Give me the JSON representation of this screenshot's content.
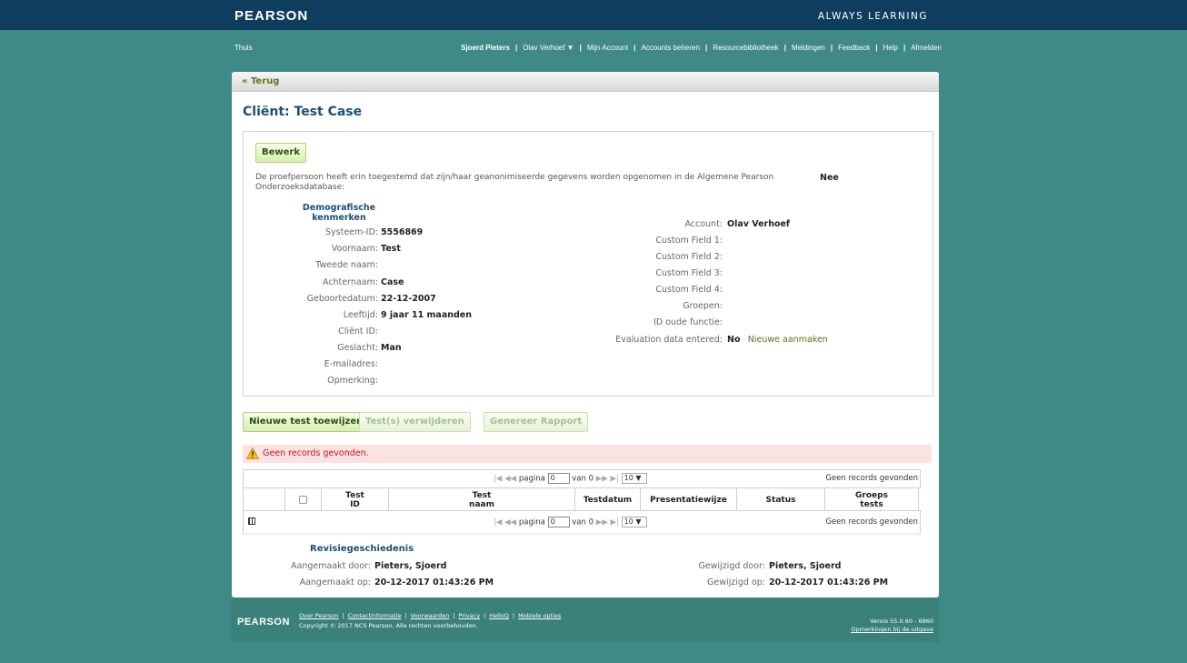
{
  "header": {
    "logo": "PEARSON",
    "tagline": "ALWAYS LEARNING"
  },
  "nav": {
    "home": "Thuis",
    "user": "Sjoerd Pieters",
    "account_menu": "Olav Verhoef ▼",
    "links": [
      "Mijn Account",
      "Accounts beheren",
      "Resourcebibliotheek",
      "Meldingen",
      "Feedback",
      "Help",
      "Afmelden"
    ]
  },
  "back": "« Terug",
  "title": "Cliënt: Test Case",
  "edit_label": "Bewerk",
  "consent": {
    "text": "De proefpersoon heeft erin toegestemd dat zijn/haar geanonimiseerde gegevens worden opgenomen in de Algemene Pearson Onderzoeksdatabase:",
    "value": "Nee"
  },
  "demographics": {
    "heading": "Demografische kenmerken",
    "fields": [
      {
        "label": "Systeem-ID:",
        "value": "5556869"
      },
      {
        "label": "Voornaam:",
        "value": "Test"
      },
      {
        "label": "Tweede naam:",
        "value": ""
      },
      {
        "label": "Achternaam:",
        "value": "Case"
      },
      {
        "label": "Geboortedatum:",
        "value": "22-12-2007"
      },
      {
        "label": "Leeftijd:",
        "value": "9 jaar 11 maanden"
      },
      {
        "label": "Cliënt ID:",
        "value": ""
      },
      {
        "label": "Geslacht:",
        "value": "Man"
      },
      {
        "label": "E-mailadres:",
        "value": ""
      },
      {
        "label": "Opmerking:",
        "value": ""
      }
    ]
  },
  "account_fields": [
    {
      "label": "Account:",
      "value": "Olav Verhoef"
    },
    {
      "label": "Custom Field 1:",
      "value": ""
    },
    {
      "label": "Custom Field 2:",
      "value": ""
    },
    {
      "label": "Custom Field 3:",
      "value": ""
    },
    {
      "label": "Custom Field 4:",
      "value": ""
    },
    {
      "label": "Groepen:",
      "value": ""
    },
    {
      "label": "ID oude functie:",
      "value": ""
    },
    {
      "label": "Evaluation data entered:",
      "value": "No",
      "link": "Nieuwe aanmaken"
    }
  ],
  "actions": {
    "assign": "Nieuwe test toewijzen",
    "delete": "Test(s) verwijderen",
    "report": "Genereer Rapport"
  },
  "alert": "Geen records gevonden.",
  "grid": {
    "pager": {
      "arrows_left": "|◀ ◀◀",
      "page_label": "pagina",
      "page_value": "0",
      "of_label": "van 0",
      "arrows_right": "▶▶ ▶|",
      "page_size": "10 ▼",
      "no_records": "Geen records gevonden"
    },
    "columns": [
      {
        "l1": "Test",
        "l2": "ID"
      },
      {
        "l1": "Test",
        "l2": "naam"
      },
      {
        "l1": "Testdatum",
        "l2": ""
      },
      {
        "l1": "Presentatiewijze",
        "l2": ""
      },
      {
        "l1": "Status",
        "l2": ""
      },
      {
        "l1": "Groeps",
        "l2": "tests"
      }
    ]
  },
  "revision": {
    "heading": "Revisiegeschiedenis",
    "created_by_label": "Aangemaakt door:",
    "created_by": "Pieters, Sjoerd",
    "created_on_label": "Aangemaakt op:",
    "created_on": "20-12-2017 01:43:26 PM",
    "modified_by_label": "Gewijzigd door:",
    "modified_by": "Pieters, Sjoerd",
    "modified_on_label": "Gewijzigd op:",
    "modified_on": "20-12-2017 01:43:26 PM"
  },
  "footer": {
    "logo": "PEARSON",
    "links": [
      "Over Pearson",
      "Contactinformatie",
      "Voorwaarden",
      "Privacy",
      "HelloQ",
      "Mobiele opties"
    ],
    "copyright": "Copyright © 2017 NCS Pearson, Alle rechten voorbehouden.",
    "version": "Versie 55.0.60 - 6860",
    "release_notes": "Opmerkingen bij de uitgave"
  },
  "colors": {
    "header_bg": "#0f3d5e",
    "page_bg": "#3f8a86",
    "title": "#1a4f77",
    "button_green": "#d5efb0",
    "alert_bg": "#fde2e2",
    "alert_text": "#cc1111"
  }
}
